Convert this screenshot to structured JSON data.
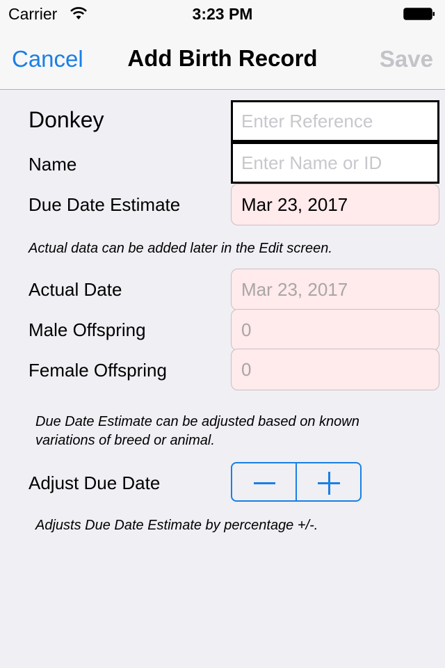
{
  "status_bar": {
    "carrier": "Carrier",
    "time": "3:23 PM",
    "wifi_icon": "wifi-icon",
    "battery_icon": "battery-full-icon"
  },
  "nav": {
    "cancel_label": "Cancel",
    "title": "Add Birth Record",
    "save_label": "Save",
    "accent_color": "#1a7fe5",
    "disabled_color": "#c3c3c8"
  },
  "form": {
    "animal_label": "Donkey",
    "reference_placeholder": "Enter Reference",
    "name_label": "Name",
    "name_placeholder": "Enter Name or ID",
    "due_date_label": "Due Date Estimate",
    "due_date_value": "Mar 23, 2017",
    "actual_note": "Actual data can be added later in the Edit screen.",
    "actual_date_label": "Actual Date",
    "actual_date_value": "Mar 23, 2017",
    "male_label": "Male Offspring",
    "male_value": "0",
    "female_label": "Female Offspring",
    "female_value": "0",
    "adjust_note_line1": "Due Date Estimate can be adjusted based on known",
    "adjust_note_line2": "variations of breed or animal.",
    "adjust_label": "Adjust Due Date",
    "stepper_minus_icon": "minus-icon",
    "stepper_plus_icon": "plus-icon",
    "adjust_footer": "Adjusts Due Date Estimate by percentage +/-."
  }
}
